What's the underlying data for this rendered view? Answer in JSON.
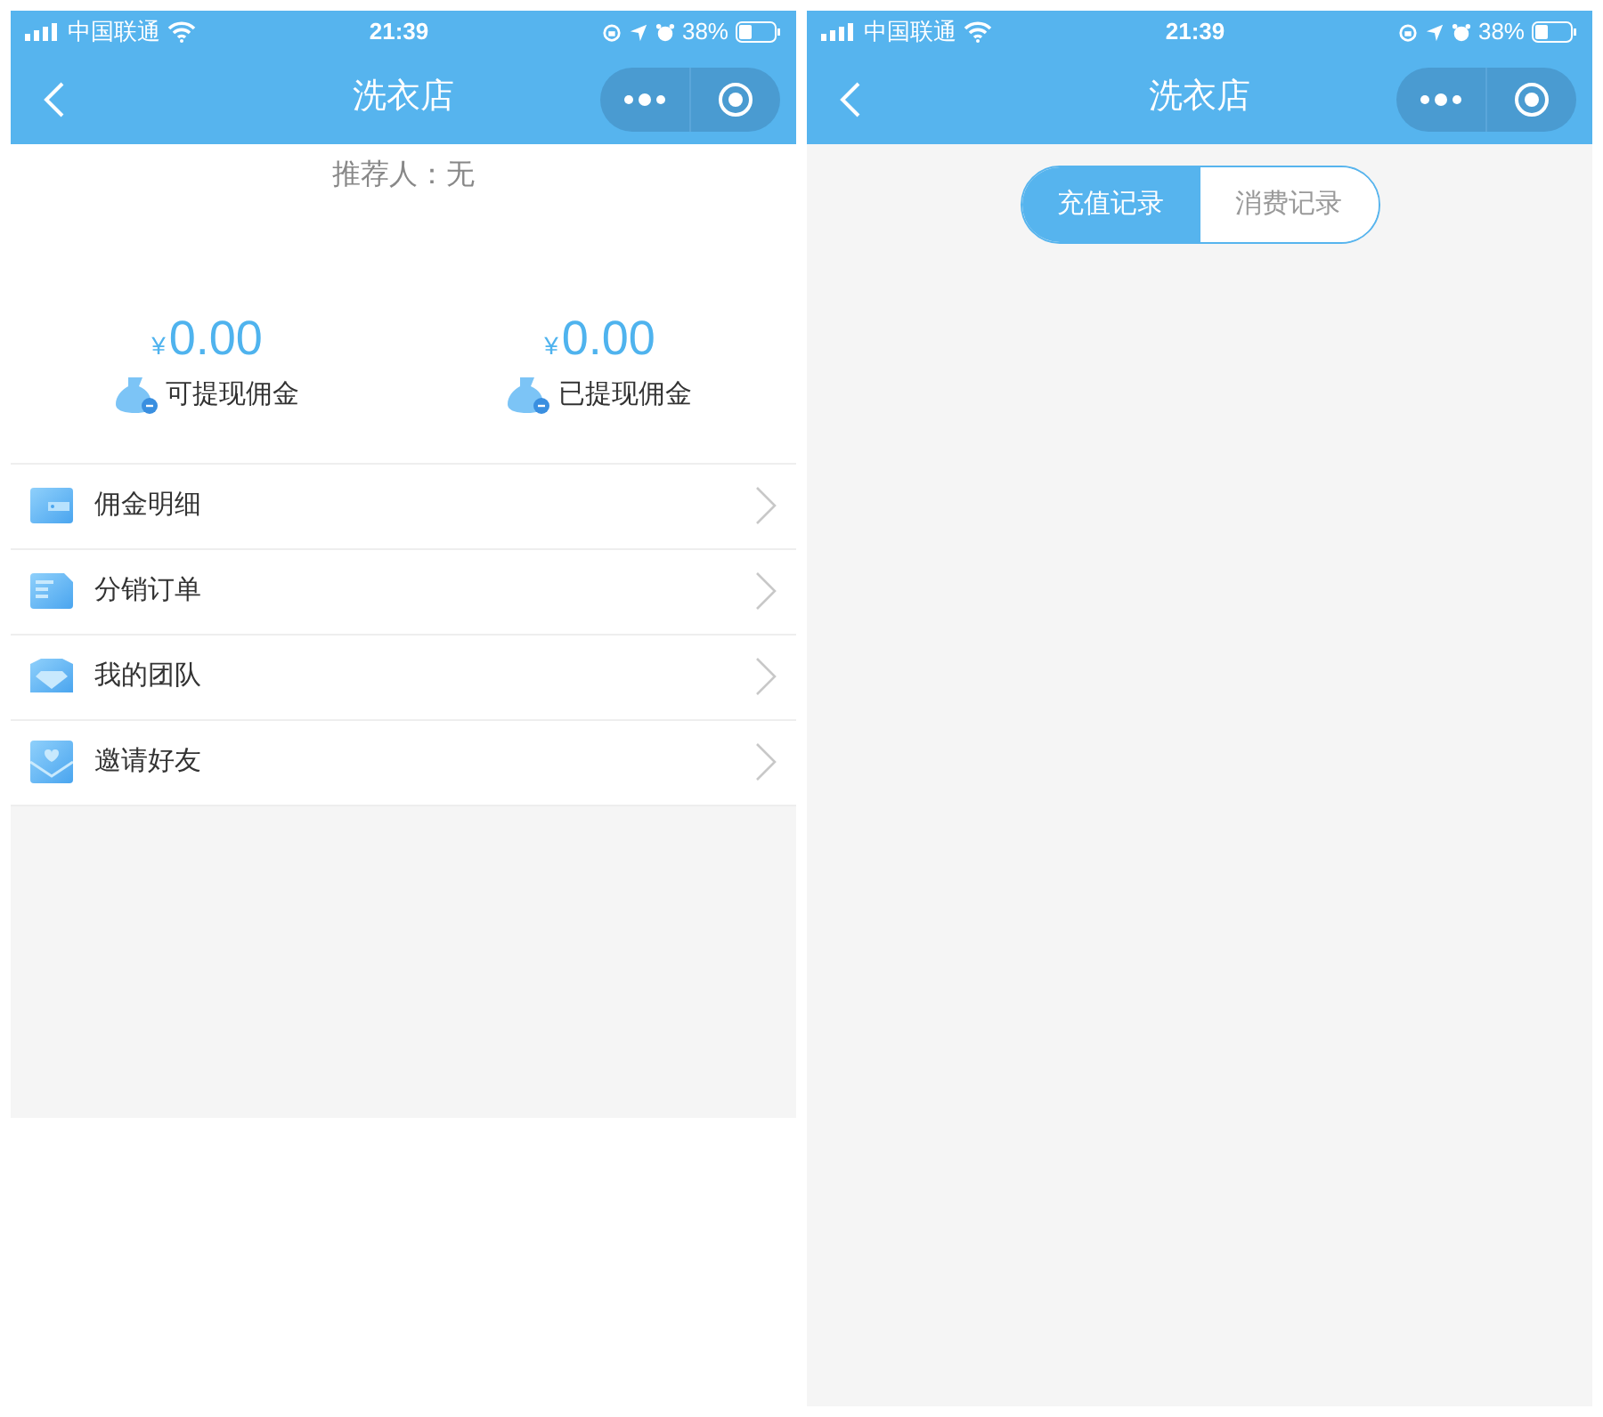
{
  "screens": [
    {
      "kind": "commission",
      "status_bar": {
        "carrier": "中国联通",
        "time": "21:39",
        "battery": "38%"
      },
      "title": "洗衣店",
      "referrer": "推荐人：无",
      "balances": [
        {
          "currency": "¥",
          "amount": "0.00",
          "label": "可提现佣金"
        },
        {
          "currency": "¥",
          "amount": "0.00",
          "label": "已提现佣金"
        }
      ],
      "menu": [
        {
          "kind": "card",
          "label": "佣金明细"
        },
        {
          "kind": "list",
          "label": "分销订单"
        },
        {
          "kind": "diamond",
          "label": "我的团队"
        },
        {
          "kind": "mail",
          "label": "邀请好友"
        }
      ]
    },
    {
      "kind": "records",
      "status_bar": {
        "carrier": "中国联通",
        "time": "21:39",
        "battery": "38%"
      },
      "title": "洗衣店",
      "tabs": [
        {
          "label": "充值记录",
          "selected": true
        },
        {
          "label": "消费记录",
          "selected": false
        }
      ]
    }
  ]
}
